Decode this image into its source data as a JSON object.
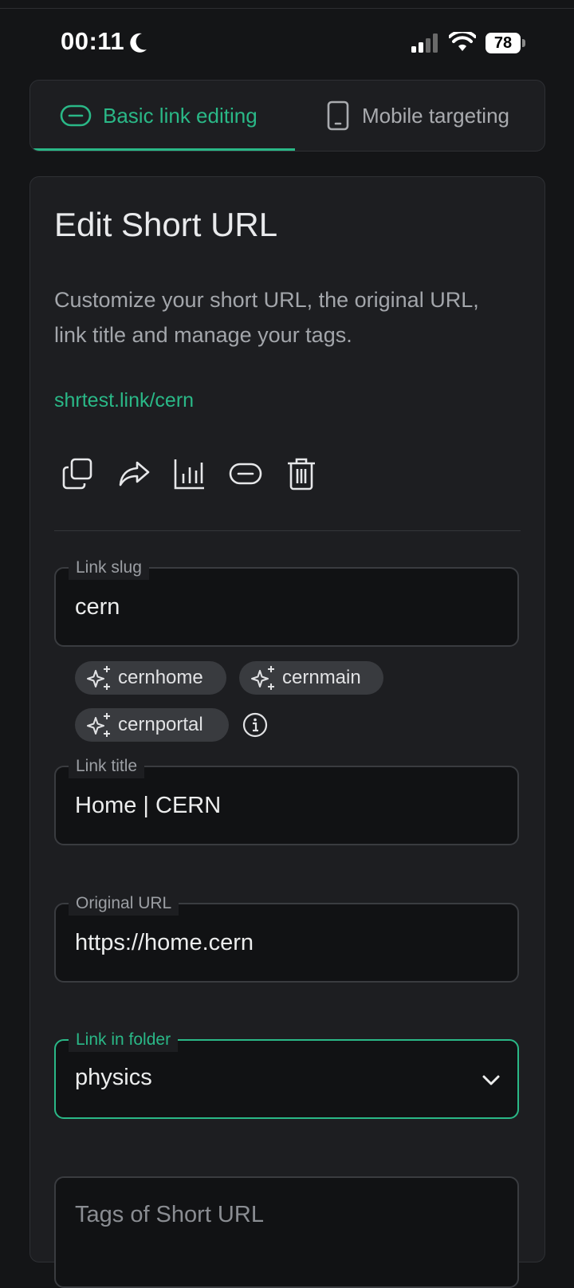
{
  "status_bar": {
    "time": "00:11",
    "battery": "78"
  },
  "tabs": [
    {
      "label": "Basic link editing",
      "icon": "link-icon",
      "active": true
    },
    {
      "label": "Mobile targeting",
      "icon": "phone-icon",
      "active": false
    }
  ],
  "card": {
    "title": "Edit Short URL",
    "description": "Customize your short URL, the original URL, link title and manage your tags.",
    "short_link": "shrtest.link/cern",
    "actions": [
      "copy-icon",
      "share-icon",
      "stats-icon",
      "link-icon",
      "delete-icon"
    ]
  },
  "form": {
    "slug": {
      "label": "Link slug",
      "value": "cern"
    },
    "suggestions": [
      "cernhome",
      "cernmain",
      "cernportal"
    ],
    "title": {
      "label": "Link title",
      "value": "Home | CERN"
    },
    "url": {
      "label": "Original URL",
      "value": "https://home.cern"
    },
    "folder": {
      "label": "Link in folder",
      "value": "physics"
    },
    "tags": {
      "placeholder": "Tags of Short URL"
    }
  },
  "colors": {
    "accent": "#2ab887",
    "background": "#141517",
    "card": "#1d1e21",
    "chip": "#393b3f"
  }
}
